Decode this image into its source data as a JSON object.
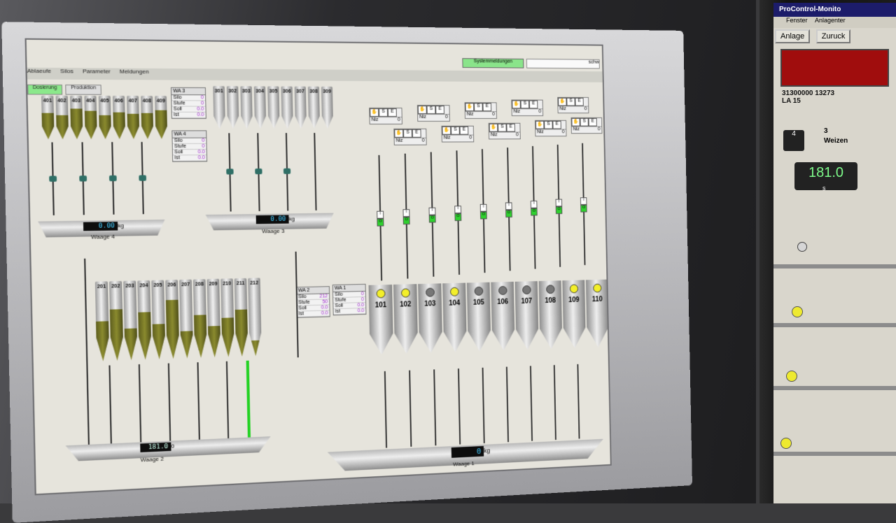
{
  "main_screen": {
    "status": {
      "system_messages": "Systemmeldungen",
      "search_text": "schw"
    },
    "menu": [
      "Ablaeufe",
      "Silos",
      "Parameter",
      "Meldungen"
    ],
    "tabs": [
      "Dosierung",
      "Produktion"
    ],
    "silos_top_left": [
      "401",
      "402",
      "403",
      "404",
      "405",
      "406",
      "407",
      "408",
      "409"
    ],
    "silos_top_mid": [
      "301",
      "302",
      "303",
      "304",
      "305",
      "306",
      "307",
      "308",
      "309"
    ],
    "silos_bottom_left": [
      "201",
      "202",
      "203",
      "204",
      "205",
      "206",
      "207",
      "208",
      "209",
      "210",
      "211",
      "212"
    ],
    "silos_right": [
      {
        "num": "101",
        "lamp": "on"
      },
      {
        "num": "102",
        "lamp": "on"
      },
      {
        "num": "103",
        "lamp": "off"
      },
      {
        "num": "104",
        "lamp": "on"
      },
      {
        "num": "105",
        "lamp": "off"
      },
      {
        "num": "106",
        "lamp": "off"
      },
      {
        "num": "107",
        "lamp": "off"
      },
      {
        "num": "108",
        "lamp": "off"
      },
      {
        "num": "109",
        "lamp": "on"
      },
      {
        "num": "110",
        "lamp": "on"
      }
    ],
    "scales": {
      "waage4": {
        "label": "Waage 4",
        "value": "0.00",
        "unit": "kg"
      },
      "waage3": {
        "label": "Waage 3",
        "value": "0.00",
        "unit": "kg"
      },
      "waage2": {
        "label": "Waage 2",
        "value": "181.0",
        "unit": "0"
      },
      "waage1": {
        "label": "Waage 1",
        "value": "0",
        "unit": "kg"
      }
    },
    "panels": {
      "wa3": {
        "title": "WA 3",
        "rows": [
          [
            "Silo",
            "0"
          ],
          [
            "Stufe",
            "0"
          ],
          [
            "Soll",
            "0.0"
          ],
          [
            "Ist",
            "0.0"
          ]
        ]
      },
      "wa4": {
        "title": "WA 4",
        "rows": [
          [
            "Silo",
            "0"
          ],
          [
            "Stufe",
            "0"
          ],
          [
            "Soll",
            "0.0"
          ],
          [
            "Ist",
            "0.0"
          ]
        ]
      },
      "wa2": {
        "title": "WA 2",
        "rows": [
          [
            "Silo",
            "212"
          ],
          [
            "Stufe",
            "50"
          ],
          [
            "Soll",
            "0.0"
          ],
          [
            "Ist",
            "0.0"
          ]
        ]
      },
      "wa1": {
        "title": "WA 1",
        "rows": [
          [
            "Silo",
            "0"
          ],
          [
            "Stufe",
            "0"
          ],
          [
            "Soll",
            "0.0"
          ],
          [
            "Ist",
            "0.0"
          ]
        ]
      }
    },
    "controls": {
      "s_label": "S",
      "e_label": "E",
      "niz_label": "Niz",
      "value": "0"
    },
    "io_labels": {
      "i": "I",
      "o": "O"
    }
  },
  "right_screen": {
    "title": "ProControl-Monito",
    "menu": [
      "Fenster",
      "Anlagenter"
    ],
    "buttons": [
      "Anlage",
      "Zuruck"
    ],
    "code_line": "31300000 13273",
    "la_line": "LA 15",
    "count": "3",
    "product": "Weizen",
    "number": "4",
    "display_value": "181.0",
    "display_unit": "s"
  },
  "colors": {
    "accent_green": "#8be88b",
    "silo_fill": "#7a7a28",
    "lamp_yellow": "#f3ef2a",
    "alarm_red": "#a00d0d"
  }
}
